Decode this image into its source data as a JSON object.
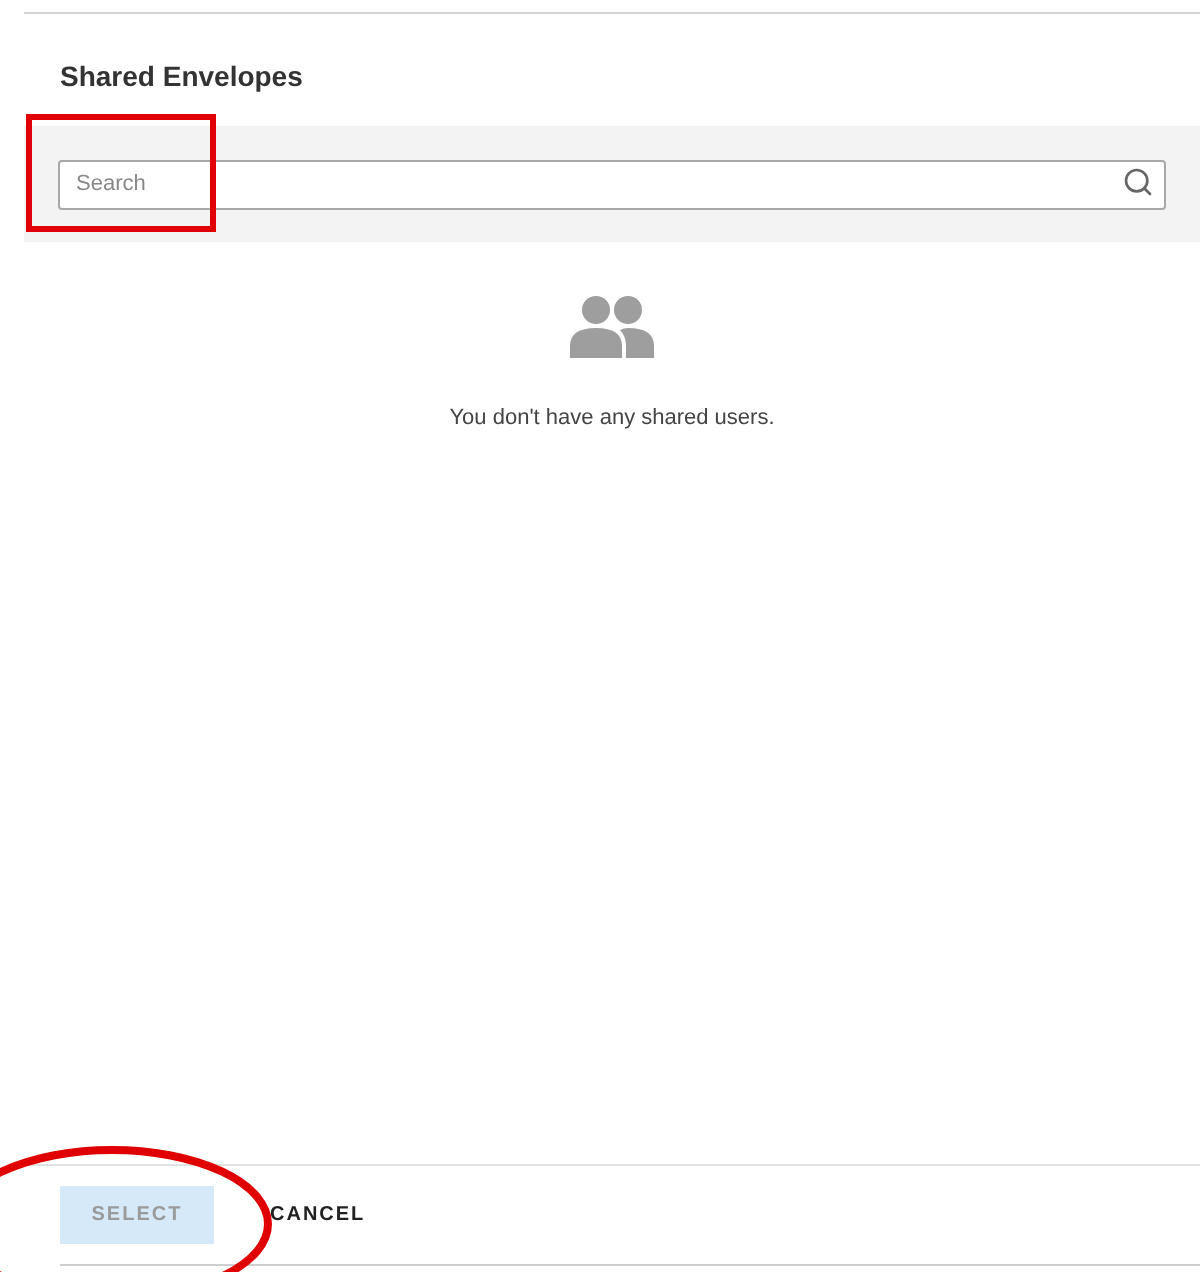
{
  "title": "Shared Envelopes",
  "search": {
    "placeholder": "Search",
    "highlighted": true
  },
  "empty_message": "You don't have any shared users.",
  "buttons": [
    {
      "label": "SELECT",
      "kind": "primary",
      "disabled": true,
      "highlighted": true
    },
    {
      "label": "CANCEL",
      "kind": "text",
      "disabled": false,
      "highlighted": false
    }
  ]
}
